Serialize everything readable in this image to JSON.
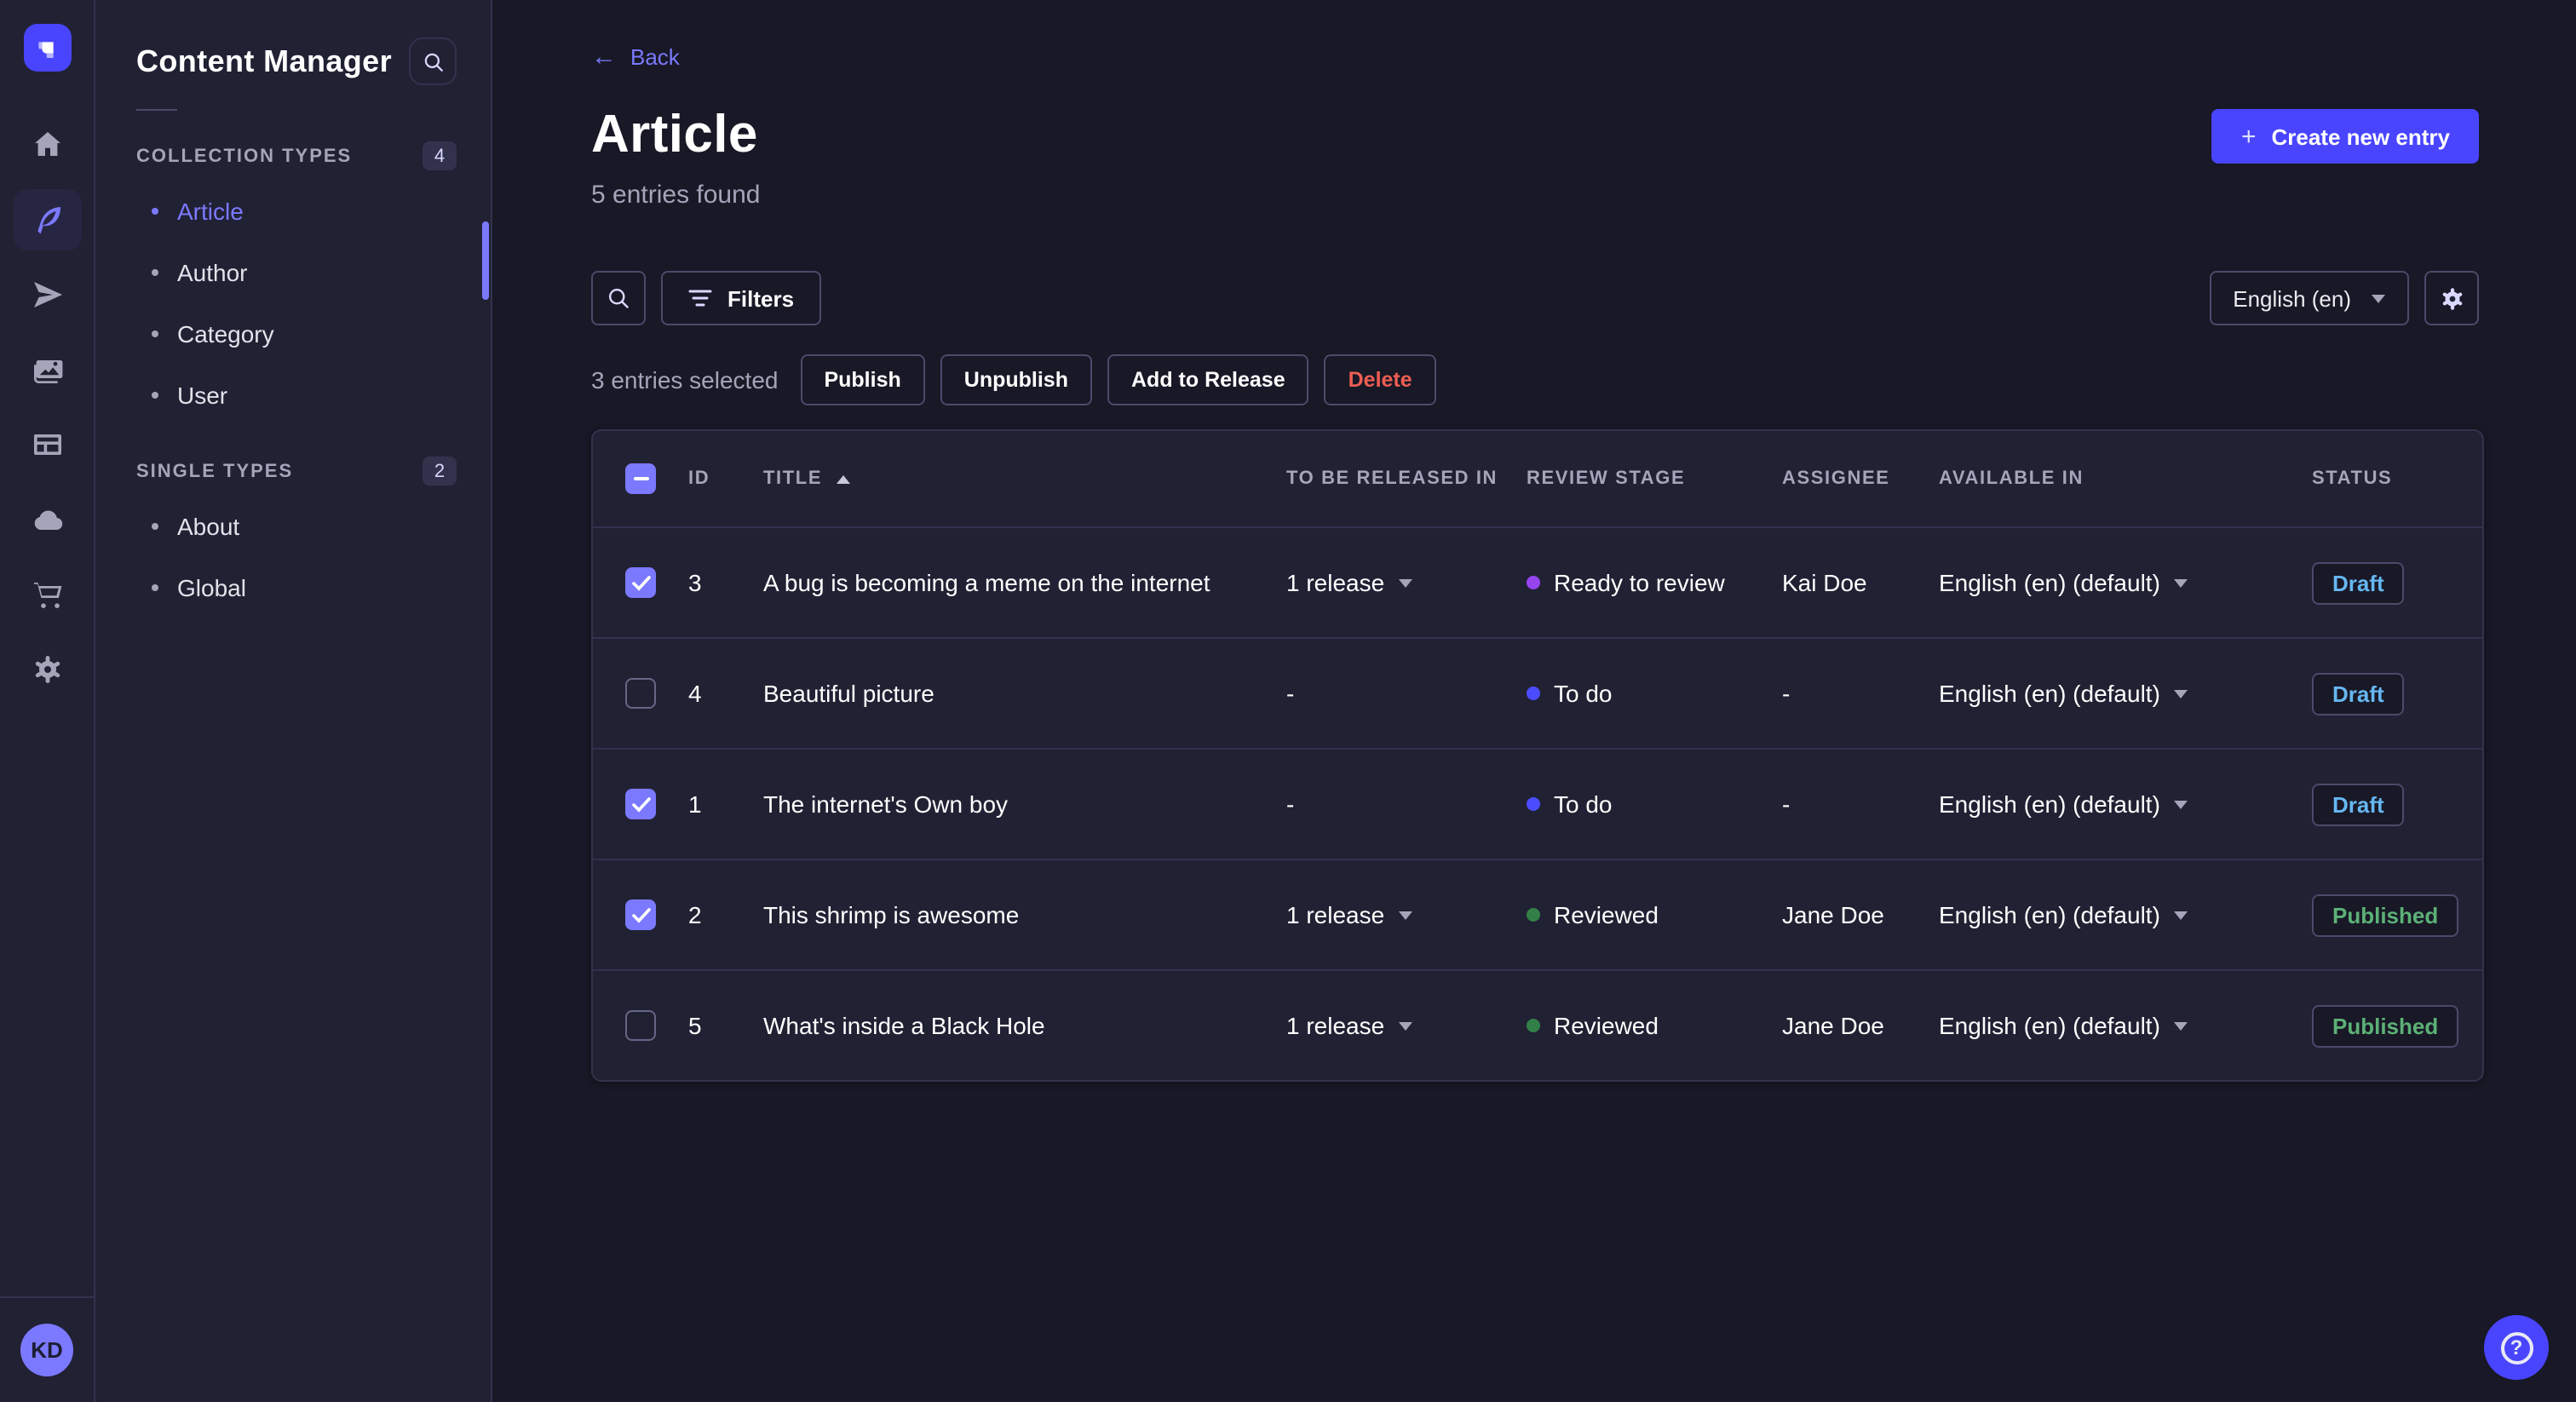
{
  "colors": {
    "primary": "#4945ff",
    "link": "#7b79ff",
    "danger": "#ee5e52",
    "draft_text": "#66b7f1",
    "published_text": "#5cb176",
    "dot_ready": "#9544ee",
    "dot_todo": "#4c4cff",
    "dot_reviewed": "#328048"
  },
  "rail": {
    "icons": [
      {
        "name": "home-icon",
        "active": false
      },
      {
        "name": "feather-icon",
        "active": true
      },
      {
        "name": "send-icon",
        "active": false
      },
      {
        "name": "media-icon",
        "active": false
      },
      {
        "name": "layout-icon",
        "active": false
      },
      {
        "name": "cloud-icon",
        "active": false
      },
      {
        "name": "cart-icon",
        "active": false
      },
      {
        "name": "gear-icon",
        "active": false
      }
    ],
    "avatar_initials": "KD"
  },
  "sidebar": {
    "title": "Content Manager",
    "sections": [
      {
        "label": "COLLECTION TYPES",
        "badge": "4",
        "items": [
          {
            "label": "Article",
            "active": true
          },
          {
            "label": "Author",
            "active": false
          },
          {
            "label": "Category",
            "active": false
          },
          {
            "label": "User",
            "active": false
          }
        ]
      },
      {
        "label": "SINGLE TYPES",
        "badge": "2",
        "items": [
          {
            "label": "About",
            "active": false
          },
          {
            "label": "Global",
            "active": false
          }
        ]
      }
    ]
  },
  "header": {
    "back_label": "Back",
    "title": "Article",
    "subtitle": "5 entries found",
    "create_button": "Create new entry"
  },
  "toolbar": {
    "filters_label": "Filters",
    "locale_value": "English (en)"
  },
  "selection": {
    "text": "3 entries selected",
    "actions": [
      {
        "label": "Publish",
        "variant": "default"
      },
      {
        "label": "Unpublish",
        "variant": "default"
      },
      {
        "label": "Add to Release",
        "variant": "default"
      },
      {
        "label": "Delete",
        "variant": "danger"
      }
    ]
  },
  "table": {
    "columns": [
      "ID",
      "TITLE",
      "TO BE RELEASED IN",
      "REVIEW STAGE",
      "ASSIGNEE",
      "AVAILABLE IN",
      "STATUS"
    ],
    "sorted_column": "TITLE",
    "rows": [
      {
        "checked": true,
        "id": "3",
        "title": "A bug is becoming a meme on the internet",
        "released_in": "1 release",
        "released_has_menu": true,
        "review_stage": "Ready to review",
        "review_color": "#9544ee",
        "assignee": "Kai Doe",
        "available_in": "English (en) (default)",
        "status": "Draft",
        "status_color": "#66b7f1"
      },
      {
        "checked": false,
        "id": "4",
        "title": "Beautiful picture",
        "released_in": "-",
        "released_has_menu": false,
        "review_stage": "To do",
        "review_color": "#4c4cff",
        "assignee": "-",
        "available_in": "English (en) (default)",
        "status": "Draft",
        "status_color": "#66b7f1"
      },
      {
        "checked": true,
        "id": "1",
        "title": "The internet's Own boy",
        "released_in": "-",
        "released_has_menu": false,
        "review_stage": "To do",
        "review_color": "#4c4cff",
        "assignee": "-",
        "available_in": "English (en) (default)",
        "status": "Draft",
        "status_color": "#66b7f1"
      },
      {
        "checked": true,
        "id": "2",
        "title": "This shrimp is awesome",
        "released_in": "1 release",
        "released_has_menu": true,
        "review_stage": "Reviewed",
        "review_color": "#328048",
        "assignee": "Jane Doe",
        "available_in": "English (en) (default)",
        "status": "Published",
        "status_color": "#5cb176"
      },
      {
        "checked": false,
        "id": "5",
        "title": "What's inside a Black Hole",
        "released_in": "1 release",
        "released_has_menu": true,
        "review_stage": "Reviewed",
        "review_color": "#328048",
        "assignee": "Jane Doe",
        "available_in": "English (en) (default)",
        "status": "Published",
        "status_color": "#5cb176"
      }
    ]
  },
  "help": {
    "icon": "?"
  }
}
